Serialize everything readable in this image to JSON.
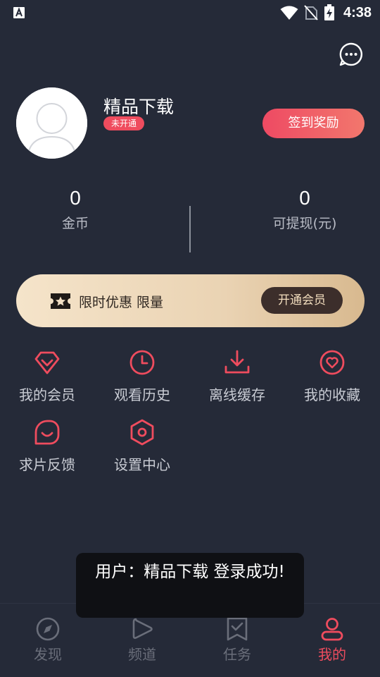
{
  "status_bar": {
    "time": "4:38",
    "icons": [
      "a-app-icon",
      "wifi-icon",
      "no-sim-icon",
      "battery-charging-icon"
    ]
  },
  "header": {
    "message_icon": "chat-bubble-dots-icon"
  },
  "profile": {
    "username": "精品下载",
    "vip_status": "未开通",
    "checkin_label": "签到奖励"
  },
  "stats": [
    {
      "value": "0",
      "label": "金币"
    },
    {
      "value": "0",
      "label": "可提现(元)"
    }
  ],
  "vip_banner": {
    "text": "限时优惠 限量",
    "button": "开通会员"
  },
  "menu": [
    {
      "label": "我的会员",
      "icon": "diamond-icon"
    },
    {
      "label": "观看历史",
      "icon": "clock-icon"
    },
    {
      "label": "离线缓存",
      "icon": "download-icon"
    },
    {
      "label": "我的收藏",
      "icon": "heart-icon"
    },
    {
      "label": "求片反馈",
      "icon": "feedback-smile-icon"
    },
    {
      "label": "设置中心",
      "icon": "settings-hexagon-icon"
    }
  ],
  "toast": {
    "text": "用户：精品下载 登录成功!"
  },
  "tabs": [
    {
      "label": "发现",
      "icon": "compass-icon",
      "active": false
    },
    {
      "label": "频道",
      "icon": "play-icon",
      "active": false
    },
    {
      "label": "任务",
      "icon": "bookmark-check-icon",
      "active": false
    },
    {
      "label": "我的",
      "icon": "user-icon",
      "active": true
    }
  ],
  "colors": {
    "background": "#252a38",
    "accent": "#ef4c5e",
    "banner_gold": "#ead3b3"
  }
}
